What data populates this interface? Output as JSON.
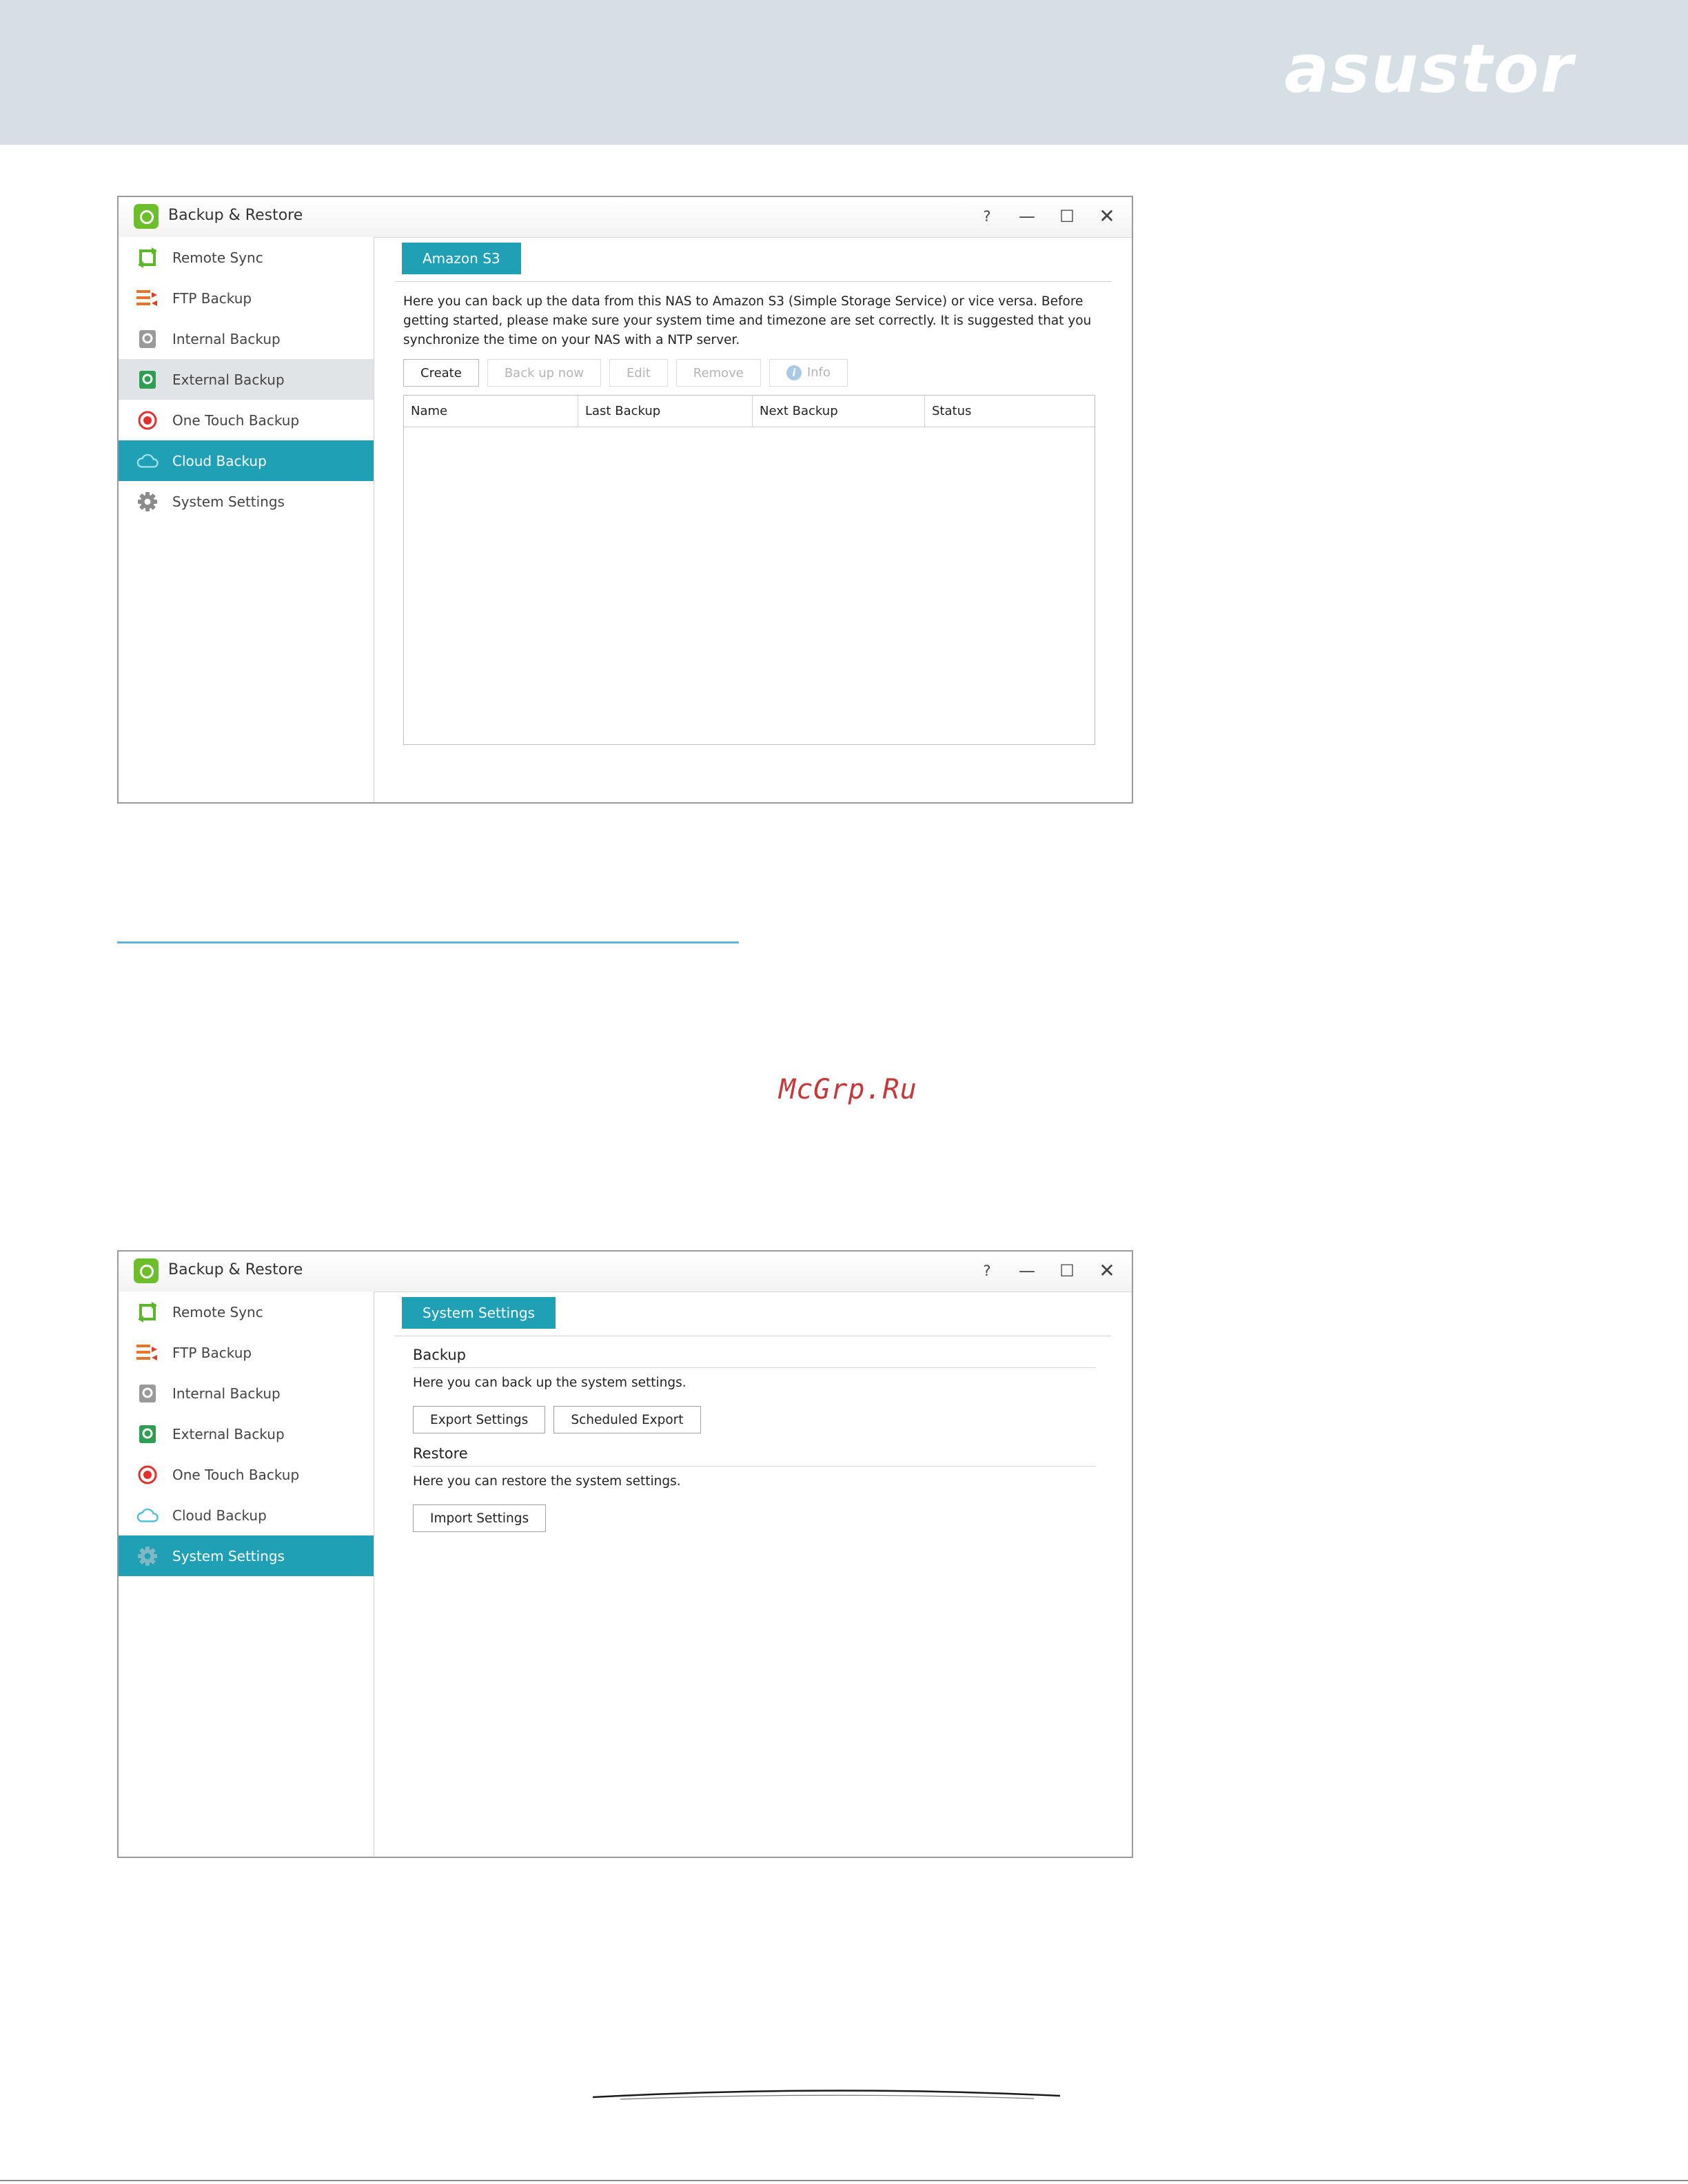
{
  "brand": {
    "logo_text": "asustor"
  },
  "watermark": "McGrp.Ru",
  "colors": {
    "accent": "#20a0b5",
    "header_band": "#d6dfe3",
    "app_icon": "#6cbf2a",
    "watermark": "#c43a3a"
  },
  "window_common": {
    "title": "Backup & Restore",
    "controls": {
      "help": "?",
      "minimize": "—",
      "maximize": "☐",
      "close": "✕"
    },
    "sidebar": [
      {
        "label": "Remote Sync",
        "icon": "remote-sync-icon"
      },
      {
        "label": "FTP Backup",
        "icon": "ftp-backup-icon"
      },
      {
        "label": "Internal Backup",
        "icon": "internal-backup-icon"
      },
      {
        "label": "External Backup",
        "icon": "external-backup-icon"
      },
      {
        "label": "One Touch Backup",
        "icon": "one-touch-backup-icon"
      },
      {
        "label": "Cloud Backup",
        "icon": "cloud-icon"
      },
      {
        "label": "System Settings",
        "icon": "gear-icon"
      }
    ]
  },
  "window1": {
    "active_item": "Cloud Backup",
    "hover_item": "External Backup",
    "tab": "Amazon S3",
    "description": "Here you can back up the data from this NAS to Amazon S3 (Simple Storage Service) or vice versa. Before getting started, please make sure your system time and timezone are set correctly. It is suggested that you synchronize the time on your NAS with a NTP server.",
    "toolbar": {
      "create": "Create",
      "backup_now": "Back up now",
      "edit": "Edit",
      "remove": "Remove",
      "info": "Info"
    },
    "table_columns": [
      "Name",
      "Last Backup",
      "Next Backup",
      "Status"
    ]
  },
  "window2": {
    "active_item": "System Settings",
    "tab": "System Settings",
    "backup": {
      "title": "Backup",
      "description": "Here you can back up the system settings.",
      "buttons": {
        "export": "Export Settings",
        "scheduled": "Scheduled Export"
      }
    },
    "restore": {
      "title": "Restore",
      "description": "Here you can restore the system settings.",
      "buttons": {
        "import": "Import Settings"
      }
    }
  }
}
